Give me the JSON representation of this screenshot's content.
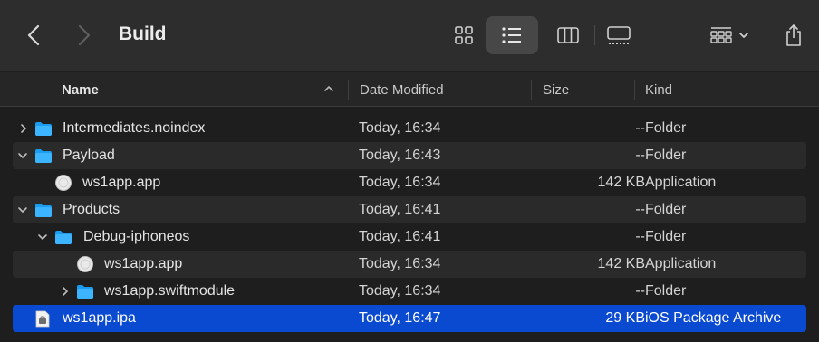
{
  "window": {
    "title": "Build"
  },
  "columns": {
    "name": "Name",
    "date": "Date Modified",
    "size": "Size",
    "kind": "Kind"
  },
  "colors": {
    "folder": "#1a9cf0",
    "selection": "#0a4ad0"
  },
  "rows": [
    {
      "name": "Intermediates.noindex",
      "date": "Today, 16:34",
      "size": "--",
      "kind": "Folder",
      "icon": "folder-icon",
      "disclosure": "collapsed"
    },
    {
      "name": "Payload",
      "date": "Today, 16:43",
      "size": "--",
      "kind": "Folder",
      "icon": "folder-icon",
      "disclosure": "expanded"
    },
    {
      "name": "ws1app.app",
      "date": "Today, 16:34",
      "size": "142 KB",
      "kind": "Application",
      "icon": "app-icon",
      "disclosure": "none"
    },
    {
      "name": "Products",
      "date": "Today, 16:41",
      "size": "--",
      "kind": "Folder",
      "icon": "folder-icon",
      "disclosure": "expanded"
    },
    {
      "name": "Debug-iphoneos",
      "date": "Today, 16:41",
      "size": "--",
      "kind": "Folder",
      "icon": "folder-icon",
      "disclosure": "expanded"
    },
    {
      "name": "ws1app.app",
      "date": "Today, 16:34",
      "size": "142 KB",
      "kind": "Application",
      "icon": "app-icon",
      "disclosure": "none"
    },
    {
      "name": "ws1app.swiftmodule",
      "date": "Today, 16:34",
      "size": "--",
      "kind": "Folder",
      "icon": "folder-icon",
      "disclosure": "collapsed"
    },
    {
      "name": "ws1app.ipa",
      "date": "Today, 16:47",
      "size": "29 KB",
      "kind": "iOS Package Archive",
      "icon": "document-icon",
      "disclosure": "none",
      "selected": true
    }
  ]
}
